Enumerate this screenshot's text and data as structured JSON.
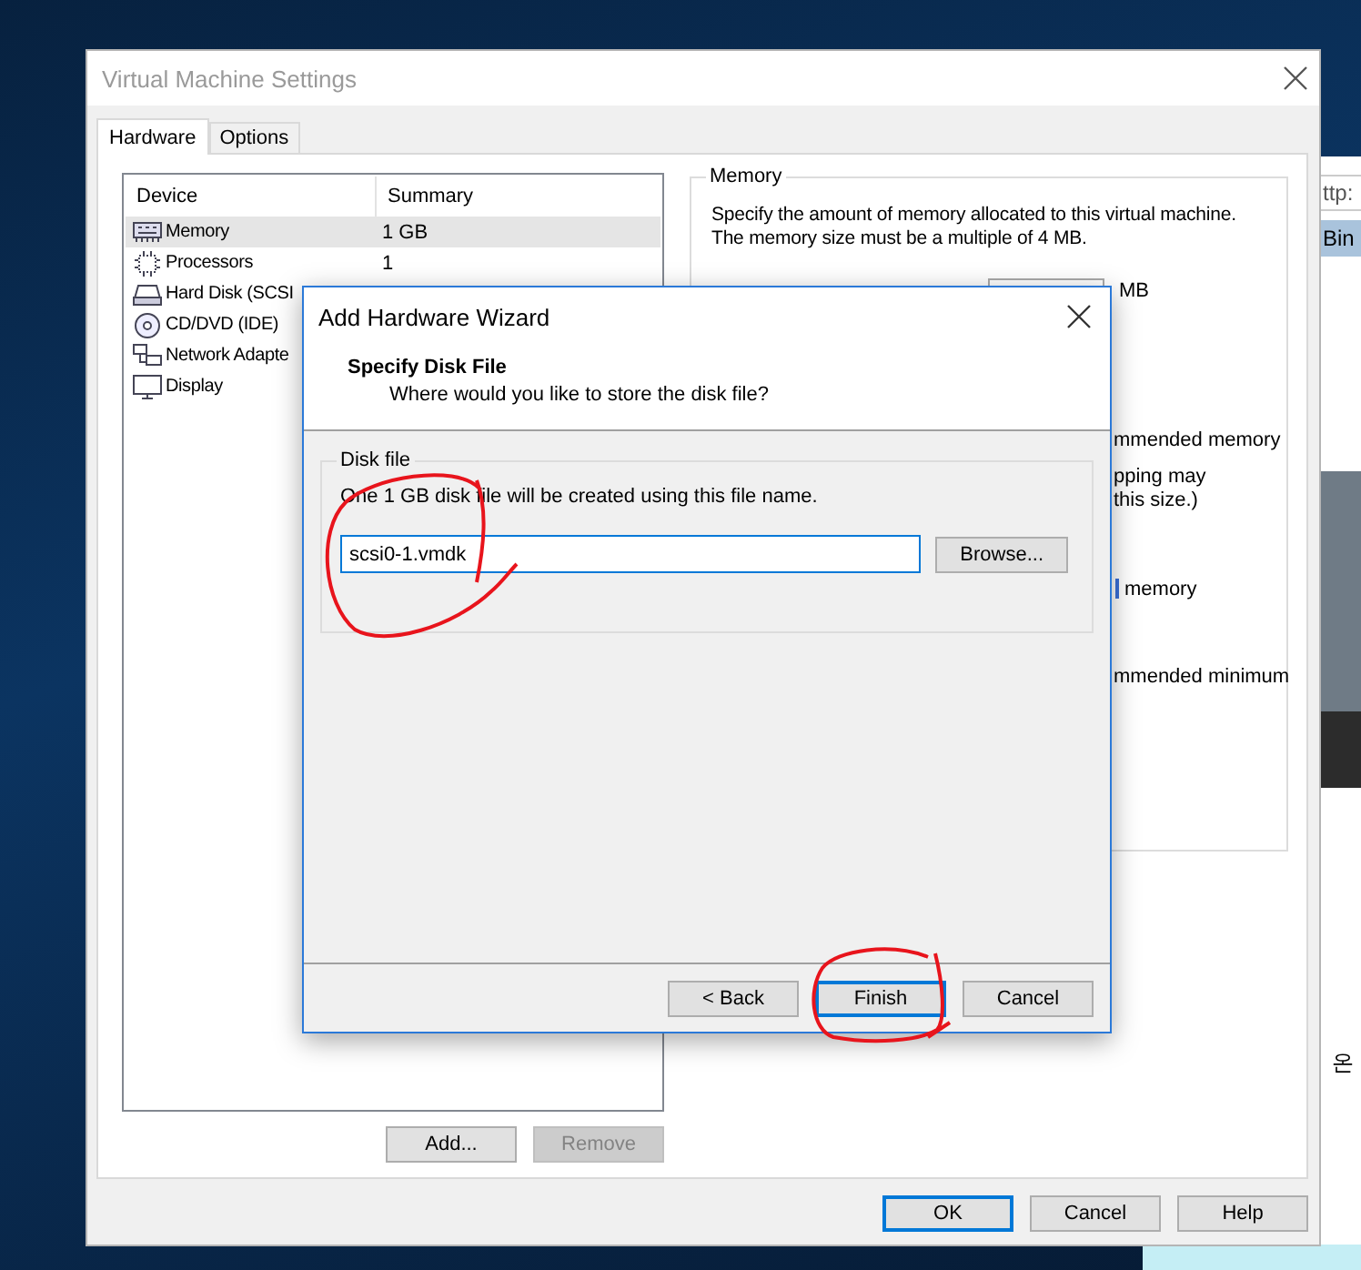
{
  "desktop": {
    "side_window": {
      "address": "ttp:",
      "list_item": "Bin",
      "text": "온"
    }
  },
  "window": {
    "title": "Virtual Machine Settings"
  },
  "tabs": [
    {
      "label": "Hardware",
      "selected": true
    },
    {
      "label": "Options",
      "selected": false
    }
  ],
  "device_list": {
    "columns": [
      "Device",
      "Summary"
    ],
    "rows": [
      {
        "kind": "memory",
        "device": "Memory",
        "summary": "1 GB",
        "selected": true
      },
      {
        "kind": "processor",
        "device": "Processors",
        "summary": "1",
        "selected": false
      },
      {
        "kind": "disk",
        "device": "Hard Disk (SCSI",
        "selected": false
      },
      {
        "kind": "cd",
        "device": "CD/DVD (IDE)",
        "selected": false
      },
      {
        "kind": "network",
        "device": "Network Adapte",
        "selected": false
      },
      {
        "kind": "display",
        "device": "Display",
        "selected": false
      }
    ]
  },
  "device_buttons": [
    {
      "label": "Add...",
      "disabled": false
    },
    {
      "label": "Remove",
      "disabled": true
    }
  ],
  "memory_panel": {
    "title": "Memory",
    "description": "Specify the amount of memory allocated to this virtual machine. The memory size must be a multiple of 4 MB.",
    "unit": "MB",
    "fragments": [
      {
        "kind": "text",
        "text": "mmended memory"
      },
      {
        "kind": "text",
        "text": "pping may"
      },
      {
        "kind": "text",
        "text": "this size.)"
      },
      {
        "kind": "legend",
        "text": "memory"
      },
      {
        "kind": "text",
        "text": "mmended minimum"
      }
    ]
  },
  "wizard": {
    "title": "Add Hardware Wizard",
    "heading": "Specify Disk File",
    "subheading": "Where would you like to store the disk file?",
    "group_title": "Disk file",
    "note": "One 1 GB disk file will be created using this file name.",
    "file_name": "scsi0-1.vmdk",
    "file_circled": true,
    "browse": "Browse...",
    "buttons": [
      {
        "label": "< Back",
        "default": false,
        "circled": false
      },
      {
        "label": "Finish",
        "default": true,
        "circled": true
      },
      {
        "label": "Cancel",
        "default": false,
        "circled": false
      }
    ]
  },
  "buttons": [
    {
      "label": "OK",
      "default": true
    },
    {
      "label": "Cancel",
      "default": false
    },
    {
      "label": "Help",
      "default": false
    }
  ]
}
